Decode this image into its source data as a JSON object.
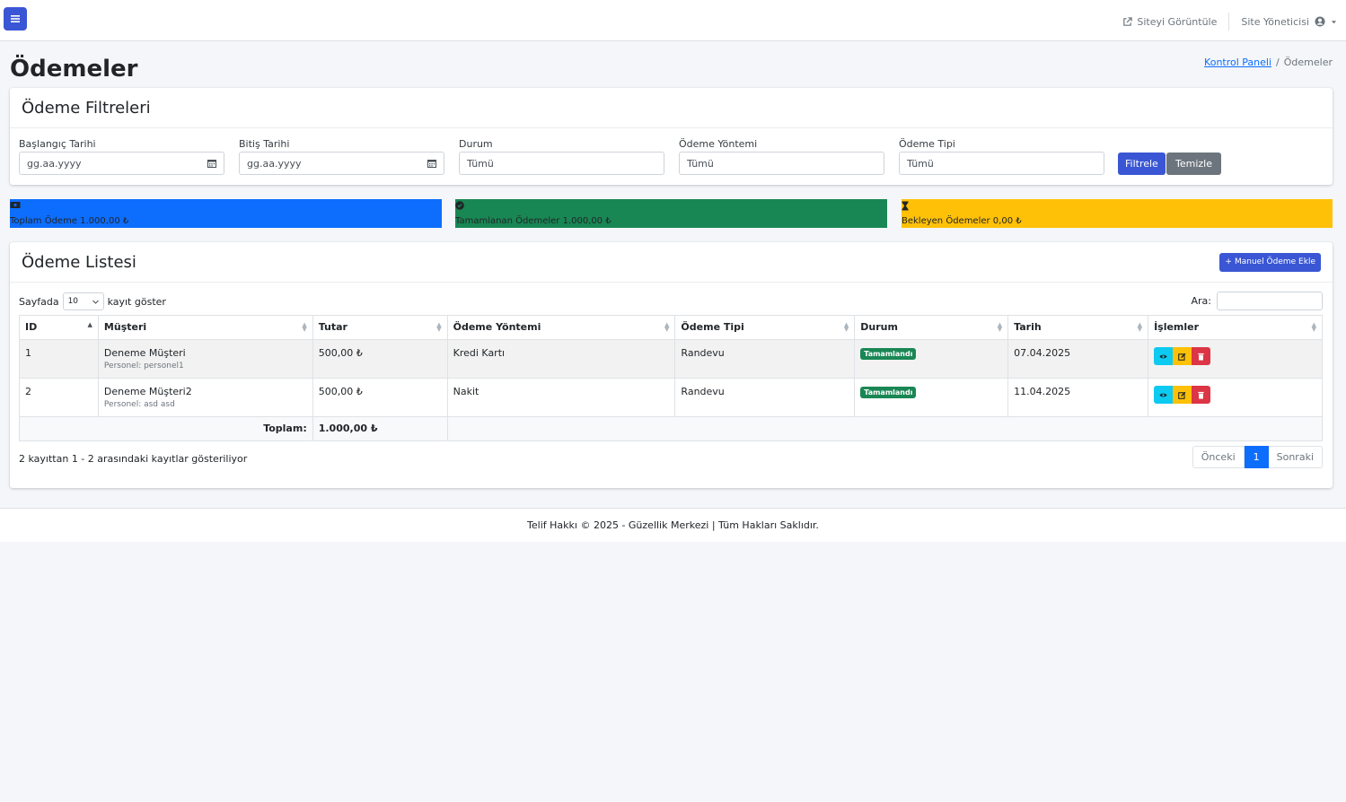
{
  "topbar": {
    "view_site": "Siteyi Görüntüle",
    "user": "Site Yöneticisi"
  },
  "header": {
    "title": "Ödemeler",
    "breadcrumb_home": "Kontrol Paneli",
    "breadcrumb_current": "Ödemeler"
  },
  "filters": {
    "title": "Ödeme Filtreleri",
    "start_label": "Başlangıç Tarihi",
    "start_placeholder": "gg.aa.yyyy",
    "end_label": "Bitiş Tarihi",
    "end_placeholder": "gg.aa.yyyy",
    "status_label": "Durum",
    "status_value": "Tümü",
    "method_label": "Ödeme Yöntemi",
    "method_value": "Tümü",
    "type_label": "Ödeme Tipi",
    "type_value": "Tümü",
    "filter_button": "Filtrele",
    "clear_button": "Temizle"
  },
  "stats": {
    "total": "Toplam Ödeme 1.000,00 ₺",
    "completed": "Tamamlanan Ödemeler 1.000,00 ₺",
    "pending": "Bekleyen Ödemeler 0,00 ₺",
    "colors": {
      "total": "#0d6efd",
      "completed": "#198754",
      "pending": "#ffc107"
    }
  },
  "list": {
    "title": "Ödeme Listesi",
    "add_button": "Manuel Ödeme Ekle",
    "length_prefix": "Sayfada",
    "length_value": "10",
    "length_suffix": "kayıt göster",
    "search_label": "Ara:",
    "columns": [
      "ID",
      "Müşteri",
      "Tutar",
      "Ödeme Yöntemi",
      "Ödeme Tipi",
      "Durum",
      "Tarih",
      "İşlemler"
    ],
    "rows": [
      {
        "id": "1",
        "customer": "Deneme Müşteri",
        "staff": "Personel: personel1",
        "amount": "500,00 ₺",
        "method": "Kredi Kartı",
        "type": "Randevu",
        "status": "Tamamlandı",
        "date": "07.04.2025"
      },
      {
        "id": "2",
        "customer": "Deneme Müşteri2",
        "staff": "Personel: asd asd",
        "amount": "500,00 ₺",
        "method": "Nakit",
        "type": "Randevu",
        "status": "Tamamlandı",
        "date": "11.04.2025"
      }
    ],
    "total_label": "Toplam:",
    "total_value": "1.000,00 ₺",
    "info": "2 kayıttan 1 - 2 arasındaki kayıtlar gösteriliyor",
    "prev": "Önceki",
    "page": "1",
    "next": "Sonraki"
  },
  "footer": {
    "text": "Telif Hakkı © 2025 - Güzellik Merkezi | Tüm Hakları Saklıdır."
  }
}
